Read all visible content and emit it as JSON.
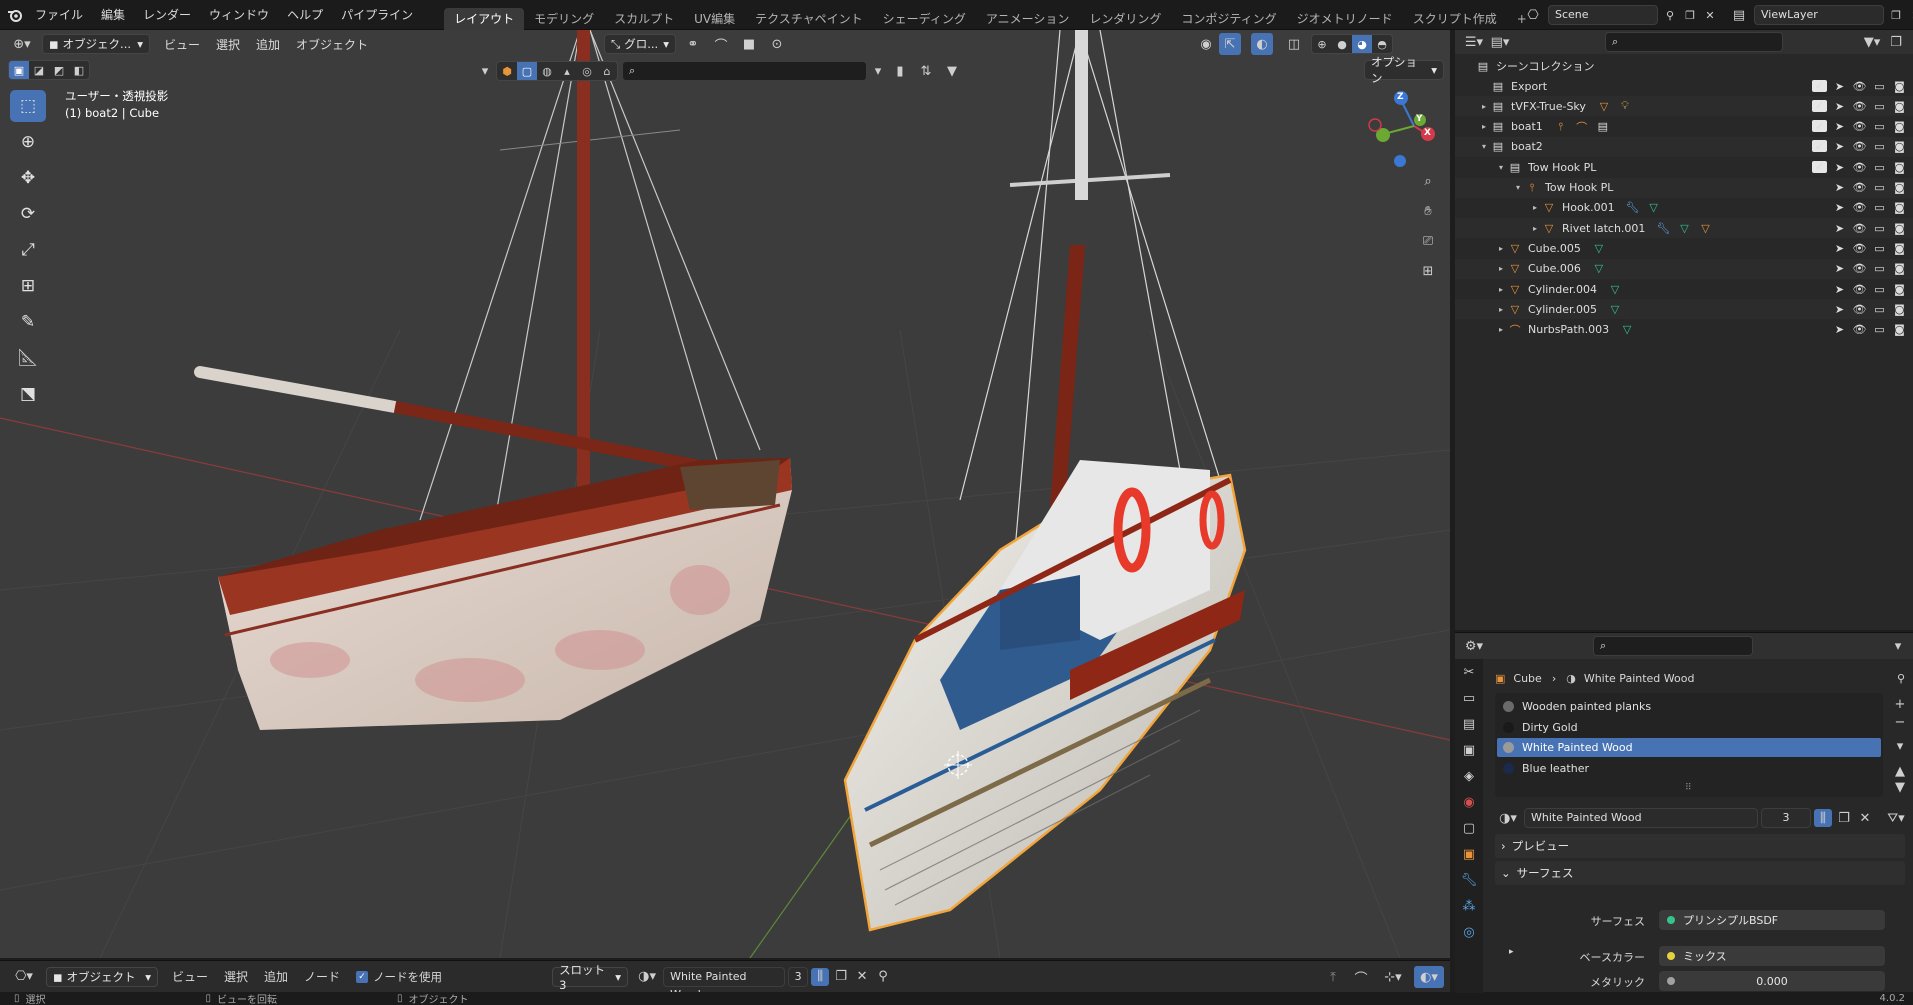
{
  "topbar": {
    "menus": [
      "ファイル",
      "編集",
      "レンダー",
      "ウィンドウ",
      "ヘルプ",
      "パイプライン"
    ],
    "workspaces": [
      {
        "label": "レイアウト",
        "active": true
      },
      {
        "label": "モデリング",
        "active": false
      },
      {
        "label": "スカルプト",
        "active": false
      },
      {
        "label": "UV編集",
        "active": false
      },
      {
        "label": "テクスチャペイント",
        "active": false
      },
      {
        "label": "シェーディング",
        "active": false
      },
      {
        "label": "アニメーション",
        "active": false
      },
      {
        "label": "レンダリング",
        "active": false
      },
      {
        "label": "コンポジティング",
        "active": false
      },
      {
        "label": "ジオメトリノード",
        "active": false
      },
      {
        "label": "スクリプト作成",
        "active": false
      }
    ],
    "add_tab": "+",
    "scene": "Scene",
    "view_layer": "ViewLayer"
  },
  "viewport": {
    "mode": "オブジェク...",
    "menus": [
      "ビュー",
      "選択",
      "追加",
      "オブジェクト"
    ],
    "transform_orientation": "グロ...",
    "options": "オプション",
    "view_name": "ユーザー・透視投影",
    "object_info": "(1) boat2 | Cube",
    "axis": {
      "z": "Z",
      "y": "Y",
      "x": "X"
    }
  },
  "outliner": {
    "title": "シーンコレクション",
    "rows": [
      {
        "label": "Export",
        "depth": 1,
        "tri": "",
        "icon": "coll",
        "checkbox": true,
        "extras": []
      },
      {
        "label": "tVFX-True-Sky",
        "depth": 1,
        "tri": "▸",
        "icon": "coll",
        "checkbox": true,
        "extras": [
          "mesh",
          "light"
        ]
      },
      {
        "label": "boat1",
        "depth": 1,
        "tri": "▸",
        "icon": "coll",
        "checkbox": true,
        "extras": [
          "arm",
          "curve",
          "coll"
        ]
      },
      {
        "label": "boat2",
        "depth": 1,
        "tri": "▾",
        "icon": "coll",
        "checkbox": true,
        "extras": []
      },
      {
        "label": "Tow Hook PL",
        "depth": 2,
        "tri": "▾",
        "icon": "coll",
        "checkbox": true,
        "extras": []
      },
      {
        "label": "Tow Hook PL",
        "depth": 3,
        "tri": "▾",
        "icon": "arm",
        "checkbox": false,
        "extras": []
      },
      {
        "label": "Hook.001",
        "depth": 4,
        "tri": "▸",
        "icon": "mesh",
        "checkbox": false,
        "extras": [
          "mod",
          "data"
        ]
      },
      {
        "label": "Rivet latch.001",
        "depth": 4,
        "tri": "▸",
        "icon": "mesh",
        "checkbox": false,
        "extras": [
          "mod",
          "data",
          "mesh"
        ]
      },
      {
        "label": "Cube.005",
        "depth": 2,
        "tri": "▸",
        "icon": "mesh",
        "checkbox": false,
        "extras": [
          "data"
        ]
      },
      {
        "label": "Cube.006",
        "depth": 2,
        "tri": "▸",
        "icon": "mesh",
        "checkbox": false,
        "extras": [
          "data"
        ]
      },
      {
        "label": "Cylinder.004",
        "depth": 2,
        "tri": "▸",
        "icon": "mesh",
        "checkbox": false,
        "extras": [
          "data"
        ]
      },
      {
        "label": "Cylinder.005",
        "depth": 2,
        "tri": "▸",
        "icon": "mesh",
        "checkbox": false,
        "extras": [
          "data"
        ]
      },
      {
        "label": "NurbsPath.003",
        "depth": 2,
        "tri": "▸",
        "icon": "curve",
        "checkbox": false,
        "extras": [
          "data"
        ]
      }
    ]
  },
  "properties": {
    "breadcrumb_object": "Cube",
    "breadcrumb_material": "White Painted Wood",
    "materials": [
      {
        "label": "Wooden painted planks",
        "color": "#6a6a6a",
        "selected": false
      },
      {
        "label": "Dirty Gold",
        "color": "#1a1a1a",
        "selected": false
      },
      {
        "label": "White Painted Wood",
        "color": "#9a9a9a",
        "selected": true
      },
      {
        "label": "Blue leather",
        "color": "#1b2a4a",
        "selected": false
      }
    ],
    "material_name": "White Painted Wood",
    "user_count": "3",
    "panel_preview": "プレビュー",
    "panel_surface": "サーフェス",
    "surface_label": "サーフェス",
    "surface_value": "プリンシプルBSDF",
    "base_color_label": "ベースカラー",
    "base_color_value": "ミックス",
    "metallic_label": "メタリック",
    "metallic_value": "0.000"
  },
  "node_header": {
    "mode": "オブジェクト",
    "menus": [
      "ビュー",
      "選択",
      "追加",
      "ノード"
    ],
    "use_nodes": "ノードを使用",
    "slot": "スロット3",
    "material": "White Painted Wood",
    "count": "3"
  },
  "statusbar": {
    "select": "選択",
    "rotate": "ビューを回転",
    "object": "オブジェクト",
    "version": "4.0.2"
  },
  "colors": {
    "accent": "#4772b3",
    "selection_outline": "#f2a53a",
    "mesh_icon": "#e8943a",
    "data_icon": "#33c48a"
  }
}
